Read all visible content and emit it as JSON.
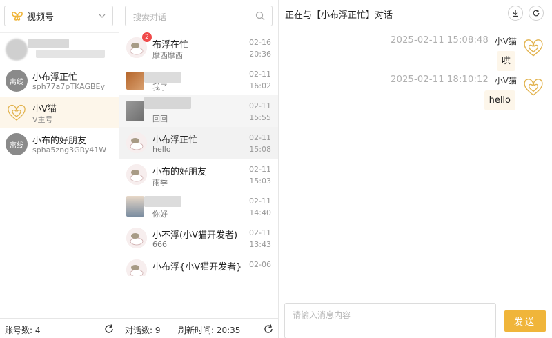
{
  "accounts_panel": {
    "platform": {
      "name": "视频号",
      "icon": "butterfly-icon",
      "accent": "#f0b53a"
    },
    "items": [
      {
        "name": "",
        "sub": "",
        "status": "blurred"
      },
      {
        "name": "小布浮正忙",
        "sub": "sph77a7pTKAGBEy",
        "badge": "离线"
      },
      {
        "name": "小V猫",
        "sub": "V主号",
        "status": "selected"
      },
      {
        "name": "小布的好朋友",
        "sub": "spha5zng3GRy41W",
        "badge": "离线"
      }
    ],
    "footer": {
      "count_label": "账号数: 4"
    }
  },
  "conversations_panel": {
    "search_placeholder": "搜索对话",
    "items": [
      {
        "name": "布浮在忙",
        "preview": "摩西摩西",
        "date": "02-16",
        "time": "20:36",
        "badge": "2"
      },
      {
        "name": "",
        "preview": "我了",
        "date": "02-11",
        "time": "16:02",
        "blurred": true
      },
      {
        "name": "",
        "preview": "回回",
        "date": "02-11",
        "time": "15:55",
        "blurred": true
      },
      {
        "name": "小布浮正忙",
        "preview": "hello",
        "date": "02-11",
        "time": "15:08",
        "selected": true
      },
      {
        "name": "小布的好朋友",
        "preview": "雨季",
        "date": "02-11",
        "time": "15:03"
      },
      {
        "name": "",
        "preview": "你好",
        "date": "02-11",
        "time": "14:40",
        "blurred": true
      },
      {
        "name": "小不浮(小V猫开发者)",
        "preview": "666",
        "date": "02-11",
        "time": "13:43"
      },
      {
        "name": "小布浮{小V猫开发者}",
        "preview": "",
        "date": "02-06",
        "time": ""
      }
    ],
    "footer": {
      "count_label": "对话数: 9",
      "refresh_label": "刷新时间: 20:35"
    }
  },
  "chat_panel": {
    "title": "正在与【小布浮正忙】对话",
    "messages": [
      {
        "time": "2025-02-11 15:08:48",
        "sender": "小V猫",
        "text": "哄"
      },
      {
        "time": "2025-02-11 18:10:12",
        "sender": "小V猫",
        "text": "hello"
      }
    ],
    "input_placeholder": "请输入消息内容",
    "send_label": "发送"
  }
}
